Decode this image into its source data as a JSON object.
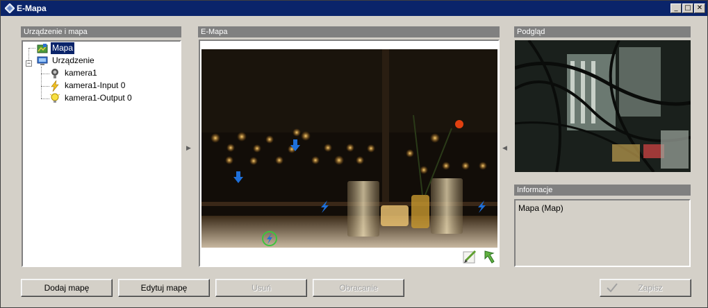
{
  "window": {
    "title": "E-Mapa",
    "minimize_glyph": "_",
    "maximize_glyph": "□",
    "close_glyph": "✕"
  },
  "device_panel": {
    "header": "Urządzenie i mapa",
    "tree": [
      {
        "label": "Mapa",
        "icon": "map-icon",
        "selected": true
      },
      {
        "label": "Urządzenie",
        "icon": "computer-icon",
        "expanded": true
      },
      {
        "label": "kamera1",
        "icon": "camera-icon"
      },
      {
        "label": "kamera1-Input 0",
        "icon": "lightning-icon"
      },
      {
        "label": "kamera1-Output 0",
        "icon": "lightbulb-icon"
      }
    ],
    "expander_glyph": "−"
  },
  "map_panel": {
    "header": "E-Mapa",
    "edit_tool_icon": "edit-icon",
    "back_tool_icon": "back-arrow-icon"
  },
  "preview_panel": {
    "header": "Podgląd"
  },
  "info_panel": {
    "header": "Informacje",
    "text": "Mapa (Map)"
  },
  "splitters": {
    "left_arrow": "▶",
    "right_arrow": "◀"
  },
  "buttons": {
    "add_map": "Dodaj mapę",
    "edit_map": "Edytuj mapę",
    "delete": "Usuń",
    "rotate": "Obracanie",
    "save": "Zapisz"
  },
  "colors": {
    "titlebar": "#0a246a",
    "selection": "#0a246a",
    "marker_blue": "#1e6fd9",
    "marker_ring": "#3cc43c"
  }
}
